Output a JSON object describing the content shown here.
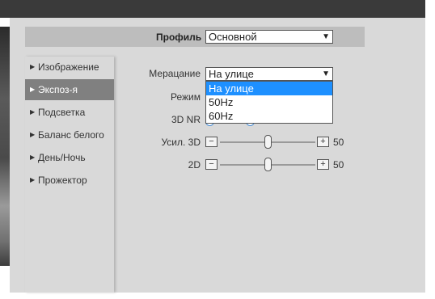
{
  "header": {
    "profile_label": "Профиль",
    "profile_value": "Основной"
  },
  "sidebar": {
    "items": [
      {
        "label": "Изображение",
        "active": false
      },
      {
        "label": "Экспоз-я",
        "active": true
      },
      {
        "label": "Подсветка",
        "active": false
      },
      {
        "label": "Баланс белого",
        "active": false
      },
      {
        "label": "День/Ночь",
        "active": false
      },
      {
        "label": "Прожектор",
        "active": false
      }
    ]
  },
  "form": {
    "flicker_label": "Мерацание",
    "flicker_value": "На улице",
    "flicker_options": [
      "На улице",
      "50Hz",
      "60Hz"
    ],
    "mode_label": "Режим",
    "nr3d_label": "3D NR",
    "gain3d_label": "Усил. 3D",
    "gain3d_value": "50",
    "nr2d_label": "2D",
    "nr2d_value": "50"
  },
  "colors": {
    "accent": "#1e90ff",
    "active_item": "#808080",
    "panel": "#d9d9d9"
  }
}
